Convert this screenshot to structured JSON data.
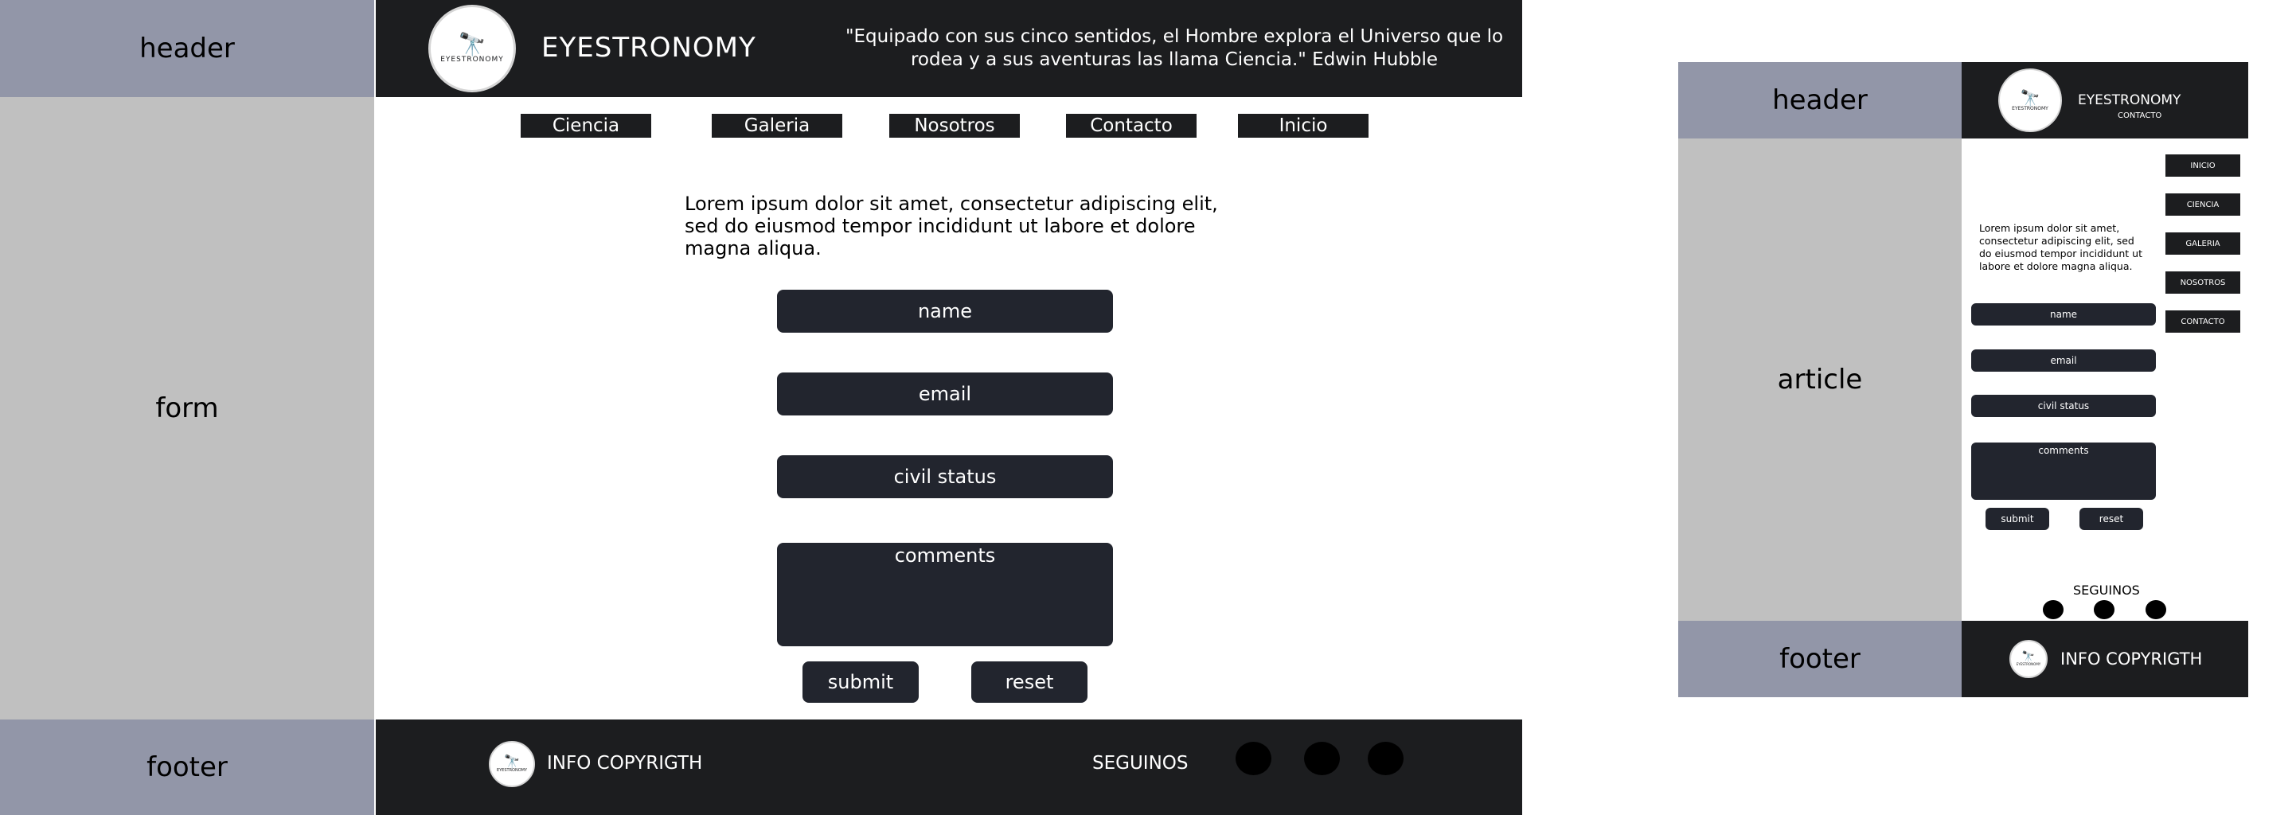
{
  "desktop": {
    "labels": {
      "header": "header",
      "form": "form",
      "footer": "footer"
    },
    "brand": {
      "title": "EYESTRONOMY",
      "logo_text": "EYESTRONOMY"
    },
    "quote": "\"Equipado con sus cinco sentidos, el Hombre explora el Universo que lo rodea y a sus aventuras las llama Ciencia.\" Edwin Hubble",
    "nav": [
      "Ciencia",
      "Galeria",
      "Nosotros",
      "Contacto",
      "Inicio"
    ],
    "intro": "Lorem ipsum dolor sit amet, consectetur adipiscing elit, sed do eiusmod tempor incididunt ut labore et dolore magna aliqua.",
    "form": {
      "name": "name",
      "email": "email",
      "civil": "civil status",
      "comments": "comments",
      "submit": "submit",
      "reset": "reset"
    },
    "footer": {
      "info": "INFO COPYRIGTH",
      "follow": "SEGUINOS"
    }
  },
  "mobile": {
    "labels": {
      "header": "header",
      "article": "article",
      "footer": "footer"
    },
    "brand": {
      "title": "EYESTRONOMY",
      "subtitle": "CONTACTO",
      "logo_text": "EYESTRONOMY"
    },
    "nav": [
      "INICIO",
      "CIENCIA",
      "GALERIA",
      "NOSOTROS",
      "CONTACTO"
    ],
    "intro": "Lorem ipsum dolor sit amet, consectetur adipiscing elit, sed do eiusmod tempor incididunt ut labore et dolore magna aliqua.",
    "form": {
      "name": "name",
      "email": "email",
      "civil": "civil status",
      "comments": "comments",
      "submit": "submit",
      "reset": "reset"
    },
    "follow": "SEGUINOS",
    "footer": {
      "info": "INFO COPYRIGTH"
    }
  },
  "colors": {
    "label_header": "#9296a8",
    "label_body": "#c0c0c0",
    "dark": "#1c1d1f",
    "field": "#22252e"
  }
}
